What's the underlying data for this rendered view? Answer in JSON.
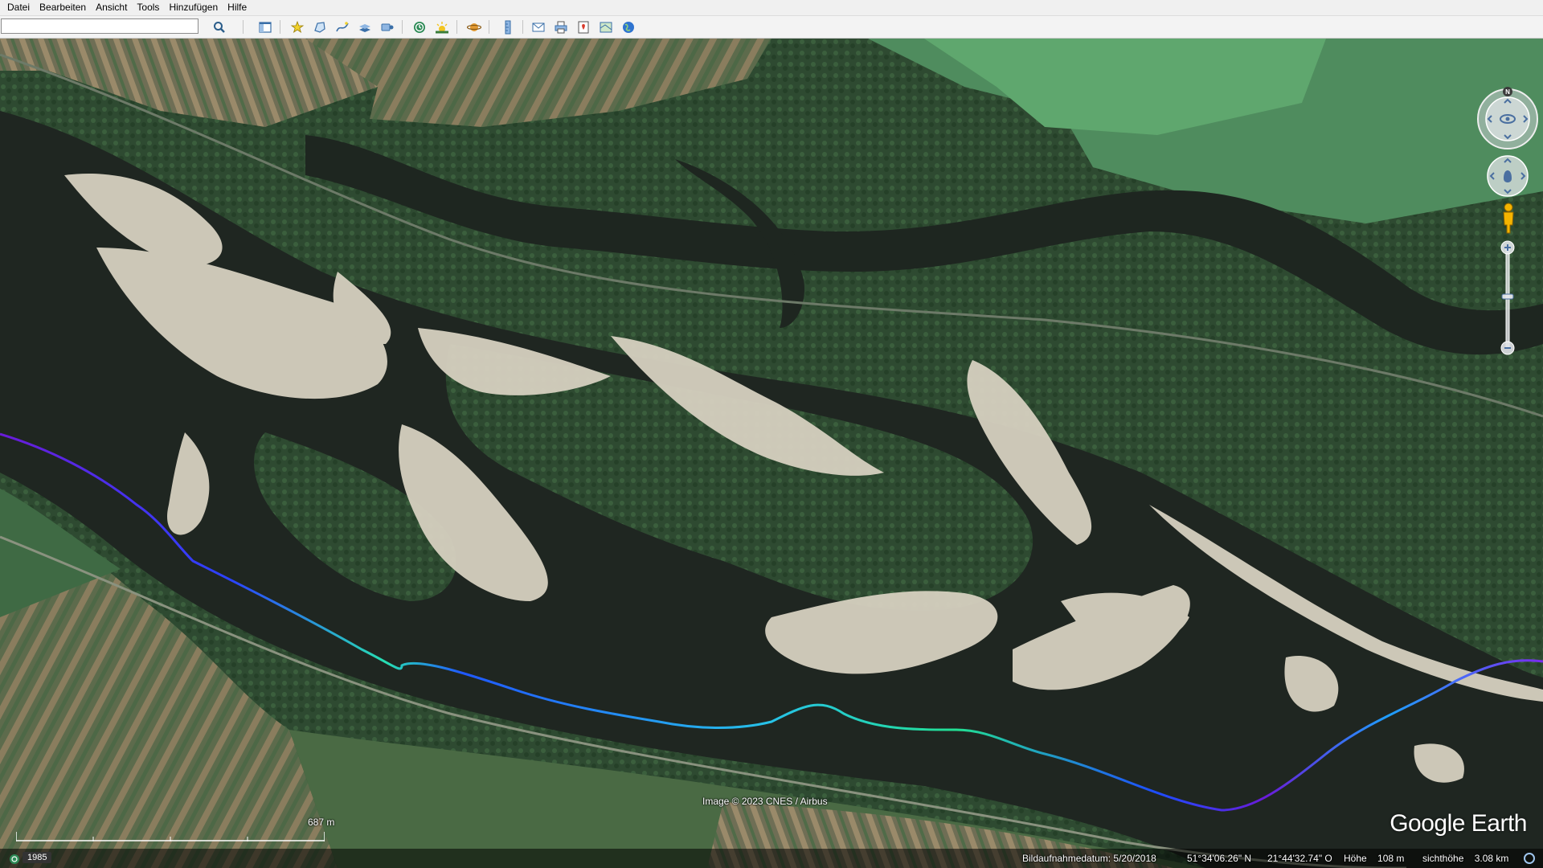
{
  "menubar": {
    "items": [
      {
        "label": "Datei"
      },
      {
        "label": "Bearbeiten"
      },
      {
        "label": "Ansicht"
      },
      {
        "label": "Tools"
      },
      {
        "label": "Hinzufügen"
      },
      {
        "label": "Hilfe"
      }
    ]
  },
  "toolbar": {
    "search_value": "",
    "buttons": [
      {
        "icon": "search-icon"
      },
      {
        "icon": "sidebar-toggle-icon"
      },
      {
        "icon": "placemark-icon"
      },
      {
        "icon": "polygon-icon"
      },
      {
        "icon": "path-icon"
      },
      {
        "icon": "image-overlay-icon"
      },
      {
        "icon": "record-tour-icon"
      },
      {
        "icon": "historical-imagery-icon"
      },
      {
        "icon": "sunlight-icon"
      },
      {
        "icon": "planets-icon"
      },
      {
        "icon": "ruler-icon"
      },
      {
        "icon": "email-icon"
      },
      {
        "icon": "print-icon"
      },
      {
        "icon": "save-image-icon"
      },
      {
        "icon": "view-in-maps-icon"
      },
      {
        "icon": "earth-icon"
      }
    ]
  },
  "map": {
    "copyright": "Image © 2023 CNES / Airbus",
    "logo": "Google Earth",
    "scale_label": "687 m"
  },
  "navigation": {
    "compass_north": "N"
  },
  "statusbar": {
    "tour_year": "1985",
    "imagery_date": "Bildaufnahmedatum: 5/20/2018",
    "latitude": "51°34'06.26\" N",
    "longitude": "21°44'32.74\" O",
    "elevation": "Höhe    108 m",
    "eye_altitude": "sichthöhe    3.08 km"
  },
  "colors": {
    "water": "#1f2621",
    "forest": "#2f4a32",
    "sand": "#d9d3c3",
    "field": "#55704f",
    "track_start": "#6a1bd8",
    "track_mid": "#1e64ff",
    "track_hot": "#27e0b3"
  }
}
